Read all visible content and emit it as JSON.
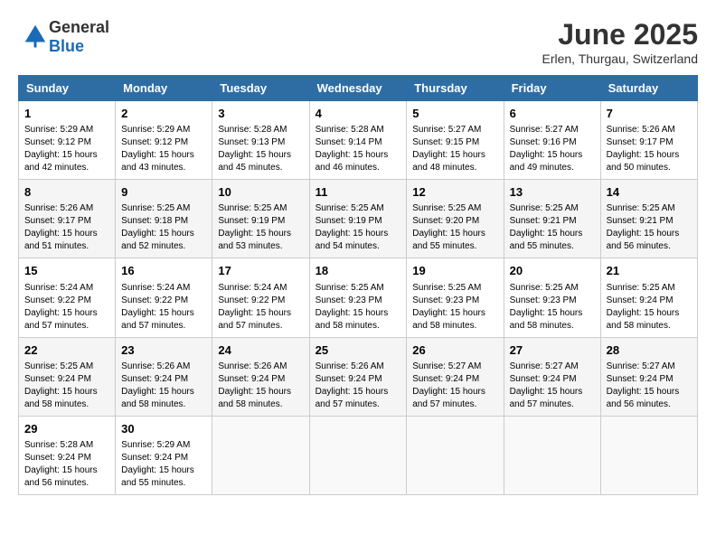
{
  "header": {
    "logo_general": "General",
    "logo_blue": "Blue",
    "month": "June 2025",
    "location": "Erlen, Thurgau, Switzerland"
  },
  "weekdays": [
    "Sunday",
    "Monday",
    "Tuesday",
    "Wednesday",
    "Thursday",
    "Friday",
    "Saturday"
  ],
  "weeks": [
    [
      {
        "day": "1",
        "sunrise": "Sunrise: 5:29 AM",
        "sunset": "Sunset: 9:12 PM",
        "daylight": "Daylight: 15 hours and 42 minutes."
      },
      {
        "day": "2",
        "sunrise": "Sunrise: 5:29 AM",
        "sunset": "Sunset: 9:12 PM",
        "daylight": "Daylight: 15 hours and 43 minutes."
      },
      {
        "day": "3",
        "sunrise": "Sunrise: 5:28 AM",
        "sunset": "Sunset: 9:13 PM",
        "daylight": "Daylight: 15 hours and 45 minutes."
      },
      {
        "day": "4",
        "sunrise": "Sunrise: 5:28 AM",
        "sunset": "Sunset: 9:14 PM",
        "daylight": "Daylight: 15 hours and 46 minutes."
      },
      {
        "day": "5",
        "sunrise": "Sunrise: 5:27 AM",
        "sunset": "Sunset: 9:15 PM",
        "daylight": "Daylight: 15 hours and 48 minutes."
      },
      {
        "day": "6",
        "sunrise": "Sunrise: 5:27 AM",
        "sunset": "Sunset: 9:16 PM",
        "daylight": "Daylight: 15 hours and 49 minutes."
      },
      {
        "day": "7",
        "sunrise": "Sunrise: 5:26 AM",
        "sunset": "Sunset: 9:17 PM",
        "daylight": "Daylight: 15 hours and 50 minutes."
      }
    ],
    [
      {
        "day": "8",
        "sunrise": "Sunrise: 5:26 AM",
        "sunset": "Sunset: 9:17 PM",
        "daylight": "Daylight: 15 hours and 51 minutes."
      },
      {
        "day": "9",
        "sunrise": "Sunrise: 5:25 AM",
        "sunset": "Sunset: 9:18 PM",
        "daylight": "Daylight: 15 hours and 52 minutes."
      },
      {
        "day": "10",
        "sunrise": "Sunrise: 5:25 AM",
        "sunset": "Sunset: 9:19 PM",
        "daylight": "Daylight: 15 hours and 53 minutes."
      },
      {
        "day": "11",
        "sunrise": "Sunrise: 5:25 AM",
        "sunset": "Sunset: 9:19 PM",
        "daylight": "Daylight: 15 hours and 54 minutes."
      },
      {
        "day": "12",
        "sunrise": "Sunrise: 5:25 AM",
        "sunset": "Sunset: 9:20 PM",
        "daylight": "Daylight: 15 hours and 55 minutes."
      },
      {
        "day": "13",
        "sunrise": "Sunrise: 5:25 AM",
        "sunset": "Sunset: 9:21 PM",
        "daylight": "Daylight: 15 hours and 55 minutes."
      },
      {
        "day": "14",
        "sunrise": "Sunrise: 5:25 AM",
        "sunset": "Sunset: 9:21 PM",
        "daylight": "Daylight: 15 hours and 56 minutes."
      }
    ],
    [
      {
        "day": "15",
        "sunrise": "Sunrise: 5:24 AM",
        "sunset": "Sunset: 9:22 PM",
        "daylight": "Daylight: 15 hours and 57 minutes."
      },
      {
        "day": "16",
        "sunrise": "Sunrise: 5:24 AM",
        "sunset": "Sunset: 9:22 PM",
        "daylight": "Daylight: 15 hours and 57 minutes."
      },
      {
        "day": "17",
        "sunrise": "Sunrise: 5:24 AM",
        "sunset": "Sunset: 9:22 PM",
        "daylight": "Daylight: 15 hours and 57 minutes."
      },
      {
        "day": "18",
        "sunrise": "Sunrise: 5:25 AM",
        "sunset": "Sunset: 9:23 PM",
        "daylight": "Daylight: 15 hours and 58 minutes."
      },
      {
        "day": "19",
        "sunrise": "Sunrise: 5:25 AM",
        "sunset": "Sunset: 9:23 PM",
        "daylight": "Daylight: 15 hours and 58 minutes."
      },
      {
        "day": "20",
        "sunrise": "Sunrise: 5:25 AM",
        "sunset": "Sunset: 9:23 PM",
        "daylight": "Daylight: 15 hours and 58 minutes."
      },
      {
        "day": "21",
        "sunrise": "Sunrise: 5:25 AM",
        "sunset": "Sunset: 9:24 PM",
        "daylight": "Daylight: 15 hours and 58 minutes."
      }
    ],
    [
      {
        "day": "22",
        "sunrise": "Sunrise: 5:25 AM",
        "sunset": "Sunset: 9:24 PM",
        "daylight": "Daylight: 15 hours and 58 minutes."
      },
      {
        "day": "23",
        "sunrise": "Sunrise: 5:26 AM",
        "sunset": "Sunset: 9:24 PM",
        "daylight": "Daylight: 15 hours and 58 minutes."
      },
      {
        "day": "24",
        "sunrise": "Sunrise: 5:26 AM",
        "sunset": "Sunset: 9:24 PM",
        "daylight": "Daylight: 15 hours and 58 minutes."
      },
      {
        "day": "25",
        "sunrise": "Sunrise: 5:26 AM",
        "sunset": "Sunset: 9:24 PM",
        "daylight": "Daylight: 15 hours and 57 minutes."
      },
      {
        "day": "26",
        "sunrise": "Sunrise: 5:27 AM",
        "sunset": "Sunset: 9:24 PM",
        "daylight": "Daylight: 15 hours and 57 minutes."
      },
      {
        "day": "27",
        "sunrise": "Sunrise: 5:27 AM",
        "sunset": "Sunset: 9:24 PM",
        "daylight": "Daylight: 15 hours and 57 minutes."
      },
      {
        "day": "28",
        "sunrise": "Sunrise: 5:27 AM",
        "sunset": "Sunset: 9:24 PM",
        "daylight": "Daylight: 15 hours and 56 minutes."
      }
    ],
    [
      {
        "day": "29",
        "sunrise": "Sunrise: 5:28 AM",
        "sunset": "Sunset: 9:24 PM",
        "daylight": "Daylight: 15 hours and 56 minutes."
      },
      {
        "day": "30",
        "sunrise": "Sunrise: 5:29 AM",
        "sunset": "Sunset: 9:24 PM",
        "daylight": "Daylight: 15 hours and 55 minutes."
      },
      null,
      null,
      null,
      null,
      null
    ]
  ]
}
